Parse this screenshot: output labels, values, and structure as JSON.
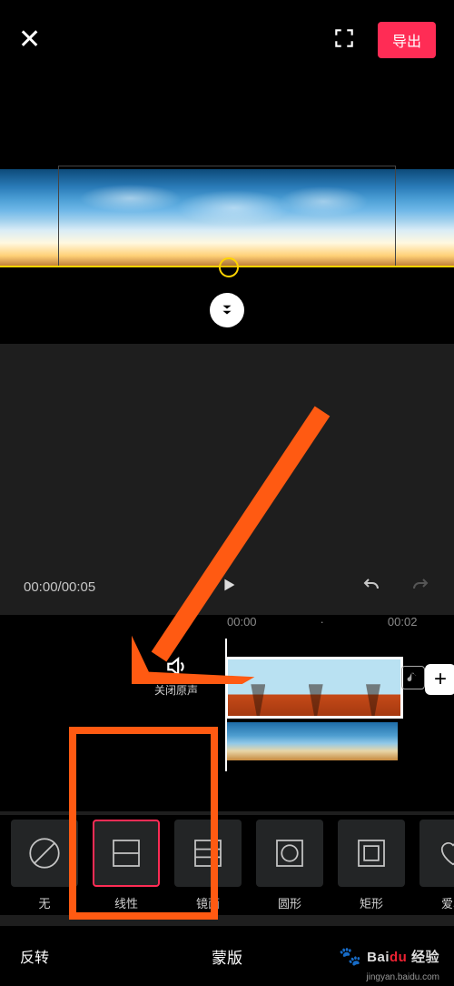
{
  "header": {
    "export_label": "导出"
  },
  "transport": {
    "time_display": "00:00/00:05"
  },
  "ruler": {
    "marks": [
      "00:00",
      "·",
      "00:02",
      "·"
    ]
  },
  "timeline": {
    "mute_label": "关闭原声",
    "add_label": "+"
  },
  "masks": {
    "items": [
      {
        "id": "none",
        "label": "无"
      },
      {
        "id": "linear",
        "label": "线性"
      },
      {
        "id": "mirror",
        "label": "镜面"
      },
      {
        "id": "circle",
        "label": "圆形"
      },
      {
        "id": "rect",
        "label": "矩形"
      },
      {
        "id": "heart",
        "label": "爱心"
      }
    ]
  },
  "bottom": {
    "left_label": "反转",
    "center_label": "蒙版"
  },
  "watermark": {
    "brand_a": "Bai",
    "brand_b": "du",
    "brand_c": "经验",
    "sub": "jingyan.baidu.com"
  }
}
